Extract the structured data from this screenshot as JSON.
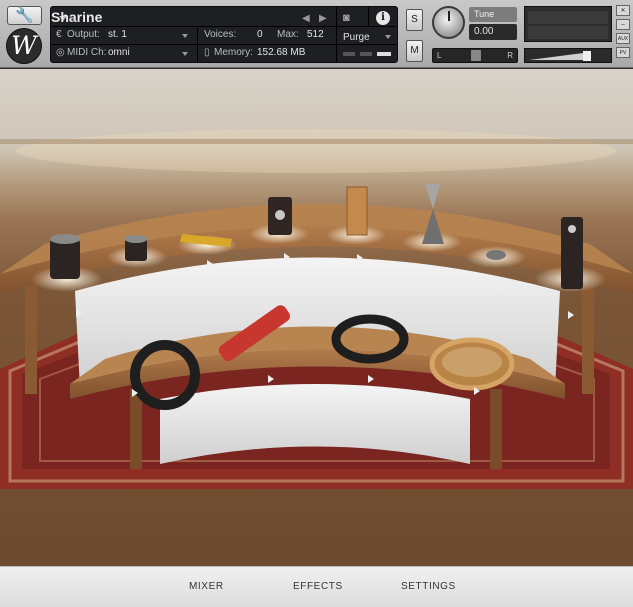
{
  "header": {
    "instrument_name": "Sharine",
    "output_label": "Output:",
    "output_value": "st. 1",
    "voices_label": "Voices:",
    "voices_value": "0",
    "max_label": "Max:",
    "max_value": "512",
    "purge_label": "Purge",
    "midi_label": "MIDI Ch:",
    "midi_value": "omni",
    "memory_label": "Memory:",
    "memory_value": "152.68 MB",
    "solo_label": "S",
    "mute_label": "M",
    "tune_label": "Tune",
    "tune_value": "0.00",
    "pan_left": "L",
    "pan_right": "R",
    "aux_label": "AUX",
    "pv_label": "PV",
    "logo_text": "W"
  },
  "footer": {
    "tabs": [
      "MIXER",
      "EFFECTS",
      "SETTINGS"
    ]
  },
  "colors": {
    "panel": "#1d1f22",
    "header": "#b8b8b8",
    "footer": "#e8e8e8",
    "wood": "#8b5a35",
    "rug": "#8c2a22"
  },
  "icons": [
    "wrench-icon",
    "camera-icon",
    "info-icon",
    "close-icon",
    "minimize-icon",
    "play-arrow-icon"
  ]
}
